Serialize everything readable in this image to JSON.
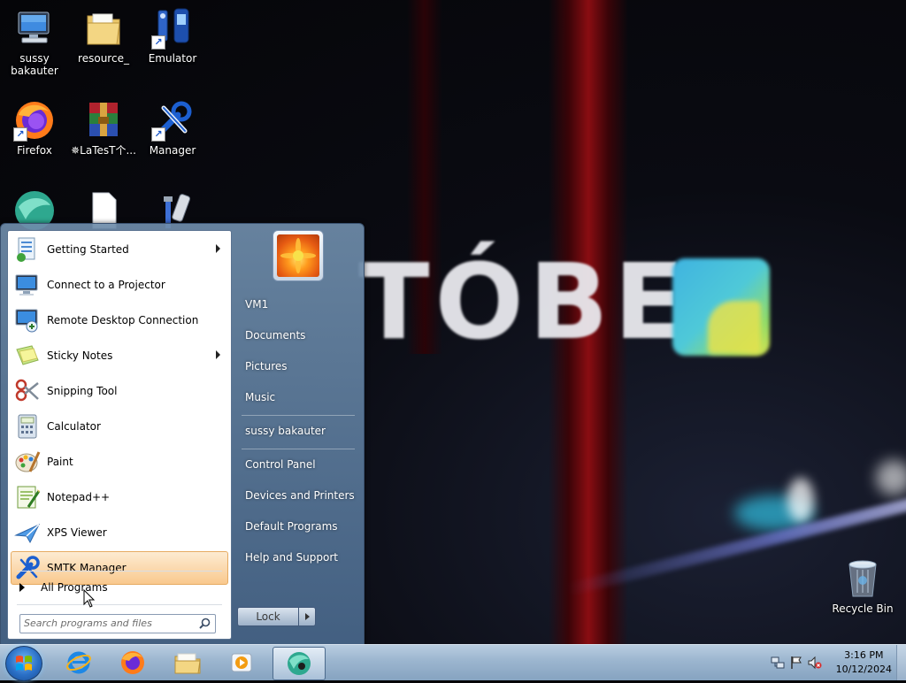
{
  "desktop": {
    "icons": [
      {
        "label": "sussy bakauter",
        "icon": "computer-icon"
      },
      {
        "label": "resource_",
        "icon": "folder-icon"
      },
      {
        "label": "Emulator",
        "icon": "emulator-icon"
      },
      {
        "label": "Firefox",
        "icon": "firefox-icon"
      },
      {
        "label": "✵LaTesT个...",
        "icon": "winrar-icon"
      },
      {
        "label": "Manager",
        "icon": "manager-tools-icon"
      },
      {
        "label": "",
        "icon": "app-globe-icon"
      },
      {
        "label": "",
        "icon": "blank-file-icon"
      },
      {
        "label": "",
        "icon": "tools-icon"
      },
      {
        "label": "Recycle Bin",
        "icon": "recycle-bin-icon"
      }
    ],
    "wallpaper_text": "TÓBE"
  },
  "start_menu": {
    "programs": [
      {
        "label": "Getting Started",
        "icon": "getting-started-icon",
        "submenu": true
      },
      {
        "label": "Connect to a Projector",
        "icon": "projector-icon",
        "submenu": false
      },
      {
        "label": "Remote Desktop Connection",
        "icon": "remote-desktop-icon",
        "submenu": false
      },
      {
        "label": "Sticky Notes",
        "icon": "sticky-notes-icon",
        "submenu": true
      },
      {
        "label": "Snipping Tool",
        "icon": "scissors-icon",
        "submenu": false
      },
      {
        "label": "Calculator",
        "icon": "calculator-icon",
        "submenu": false
      },
      {
        "label": "Paint",
        "icon": "paint-icon",
        "submenu": false
      },
      {
        "label": "Notepad++",
        "icon": "notepadpp-icon",
        "submenu": false
      },
      {
        "label": "XPS Viewer",
        "icon": "xps-viewer-icon",
        "submenu": false
      },
      {
        "label": "SMTK Manager",
        "icon": "manager-tools-icon",
        "submenu": false,
        "highlighted": true
      }
    ],
    "all_programs": "All Programs",
    "search_placeholder": "Search programs and files",
    "right_items": {
      "vm1": "VM1",
      "documents": "Documents",
      "pictures": "Pictures",
      "music": "Music",
      "user": "sussy bakauter",
      "control_panel": "Control Panel",
      "devices": "Devices and Printers",
      "default_programs": "Default Programs",
      "help": "Help and Support"
    },
    "shutdown_label": "Lock"
  },
  "taskbar": {
    "pinned": [
      "internet-explorer-icon",
      "firefox-icon",
      "explorer-folder-icon",
      "media-player-icon",
      "app-globe-icon"
    ],
    "clock_time": "3:16 PM",
    "clock_date": "10/12/2024"
  },
  "colors": {
    "highlight": "#f9c98e",
    "taskbar": "#9bb5cf",
    "start_menu_right": "#5d7ea2"
  }
}
